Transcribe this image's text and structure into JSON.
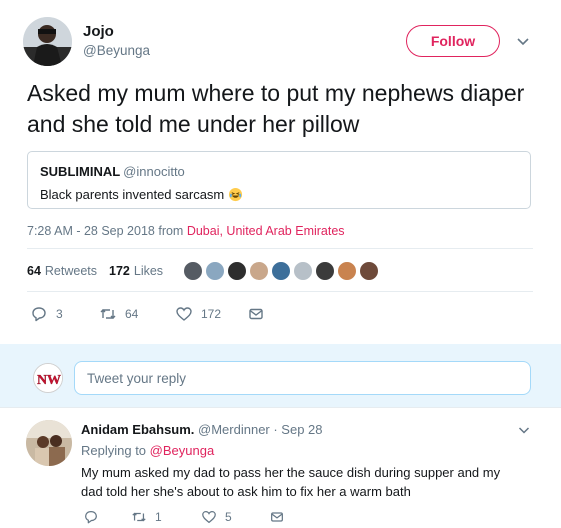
{
  "tweet": {
    "author_name": "Jojo",
    "author_handle": "@Beyunga",
    "follow_label": "Follow",
    "text": "Asked my mum where to put my nephews diaper and she told me under her pillow",
    "quote": {
      "name": "SUBLIMINAL",
      "handle": "@innocitto",
      "text": "Black parents invented sarcasm"
    },
    "timestamp": "7:28 AM - 28 Sep 2018 from ",
    "location": "Dubai, United Arab Emirates",
    "retweets_count": "64",
    "retweets_label": "Retweets",
    "likes_count": "172",
    "likes_label": "Likes",
    "actions": {
      "replies": "3",
      "retweets": "64",
      "likes": "172"
    }
  },
  "reply_box": {
    "placeholder": "Tweet your reply",
    "logo_text": "NW"
  },
  "reply": {
    "name": "Anidam Ebahsum.",
    "meta": " @Merdinner · Sep 28",
    "replying_label": "Replying to ",
    "replying_handle": "@Beyunga",
    "text": "My mum asked my dad to pass her the sauce dish during supper and my dad told her she's about to ask him to fix her a warm bath",
    "actions": {
      "retweets": "1",
      "likes": "5"
    }
  },
  "colors": {
    "accent": "#e0245e",
    "muted": "#657786",
    "text": "#14171a",
    "reply_bg": "#e8f5fd"
  }
}
